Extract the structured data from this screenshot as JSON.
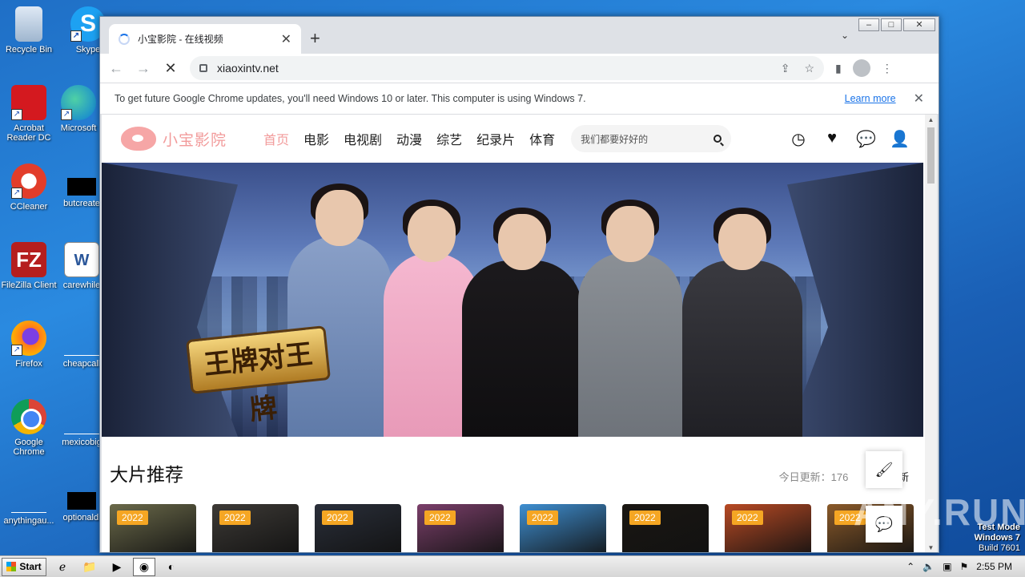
{
  "desktop": {
    "icons": [
      {
        "label": "Recycle Bin",
        "icon": "recycle-bin-icon"
      },
      {
        "label": "Skype",
        "icon": "skype-icon"
      },
      {
        "label": "Acrobat Reader DC",
        "icon": "acrobat-icon"
      },
      {
        "label": "Microsoft",
        "icon": "edge-icon"
      },
      {
        "label": "CCleaner",
        "icon": "ccleaner-icon"
      },
      {
        "label": "butcreate",
        "icon": "file-icon"
      },
      {
        "label": "FileZilla Client",
        "icon": "filezilla-icon"
      },
      {
        "label": "carewhile",
        "icon": "word-doc-icon"
      },
      {
        "label": "Firefox",
        "icon": "firefox-icon"
      },
      {
        "label": "cheapcall",
        "icon": "file-icon"
      },
      {
        "label": "Google Chrome",
        "icon": "chrome-icon"
      },
      {
        "label": "mexicobig",
        "icon": "file-icon"
      },
      {
        "label": "anythingau...",
        "icon": "file-icon"
      },
      {
        "label": "optionaldi",
        "icon": "file-icon"
      }
    ]
  },
  "browser": {
    "tab_title": "小宝影院 - 在线视频",
    "url": "xiaoxintv.net",
    "infobar_message": "To get future Google Chrome updates, you'll need Windows 10 or later. This computer is using Windows 7.",
    "infobar_link": "Learn more"
  },
  "site": {
    "logo_text": "小宝影院",
    "nav": [
      "首页",
      "电影",
      "电视剧",
      "动漫",
      "综艺",
      "纪录片",
      "体育"
    ],
    "search_placeholder": "我们都要好好的",
    "banner_show_title": "王牌对王牌",
    "section_title": "大片推荐",
    "section_update": "今日更新：176",
    "section_new": "最新更新",
    "cards": [
      {
        "year": "2022",
        "color": "#6b6a4a"
      },
      {
        "year": "2022",
        "color": "#3d3a36"
      },
      {
        "year": "2022",
        "color": "#2a2f3a"
      },
      {
        "year": "2022",
        "color": "#7b3f6a"
      },
      {
        "year": "2022",
        "color": "#3f8fd1"
      },
      {
        "year": "2022",
        "color": "#1a1712"
      },
      {
        "year": "2022",
        "color": "#b84a24"
      },
      {
        "year": "2022",
        "color": "#8a5a2a"
      }
    ]
  },
  "taskbar": {
    "start_label": "Start",
    "clock": "2:55 PM"
  },
  "watermark": {
    "line1": "Test Mode",
    "line2": "Windows 7",
    "line3": "Build 7601",
    "brand": "ANY.RUN"
  }
}
